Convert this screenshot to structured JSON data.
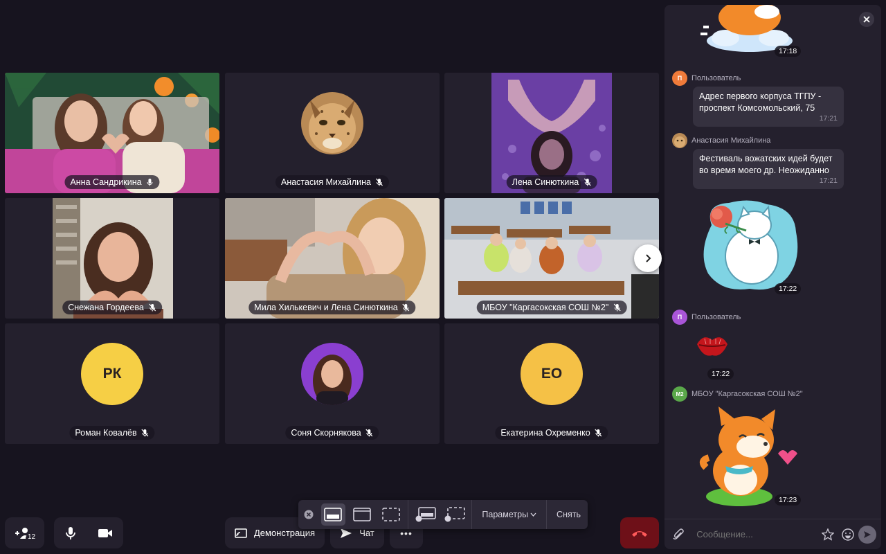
{
  "participants": [
    {
      "name": "Анна Сандрикина",
      "mic": "on",
      "active": true
    },
    {
      "name": "Анастасия Михайлина",
      "mic": "off"
    },
    {
      "name": "Лена Синюткина",
      "mic": "off"
    },
    {
      "name": "Снежана Гордеева",
      "mic": "off"
    },
    {
      "name": "Мила Хилькевич и Лена Синюткина",
      "mic": "off"
    },
    {
      "name": "МБОУ \"Каргасокская СОШ №2\"",
      "mic": "off"
    },
    {
      "name": "Роман Ковалёв",
      "mic": "off",
      "initials": "РК",
      "color": "#f6cf45"
    },
    {
      "name": "Соня Скорнякова",
      "mic": "off"
    },
    {
      "name": "Екатерина Охременко",
      "mic": "off",
      "initials": "ЕО",
      "color": "#f5c146"
    }
  ],
  "toolbar": {
    "invite_badge": "12",
    "demo_label": "Демонстрация",
    "chat_label": "Чат",
    "more_label": "•••"
  },
  "layout_popup": {
    "params_label": "Параметры",
    "remove_label": "Снять"
  },
  "chat": {
    "messages": [
      {
        "type": "sticker",
        "time": "17:18"
      },
      {
        "type": "text",
        "author": "Пользователь",
        "avatar_letter": "П",
        "text": "Адрес первого корпуса ТГПУ - проспект Комсомольский, 75",
        "time": "17:21"
      },
      {
        "type": "text",
        "author": "Анастасия Михайлина",
        "text": "Фестиваль вожатских идей будет во время моего др. Неожиданно",
        "time": "17:21"
      },
      {
        "type": "sticker",
        "time": "17:22"
      },
      {
        "type": "sticker",
        "author": "Пользователь",
        "avatar_letter": "П",
        "time": "17:22"
      },
      {
        "type": "sticker",
        "author": "МБОУ \"Каргасокская СОШ №2\"",
        "avatar_letter": "М2",
        "time": "17:23"
      }
    ],
    "input_placeholder": "Сообщение..."
  },
  "colors": {
    "background": "#17141f",
    "tile": "#24202d",
    "active_border": "#ffd23c",
    "hangup": "#6e1018"
  }
}
